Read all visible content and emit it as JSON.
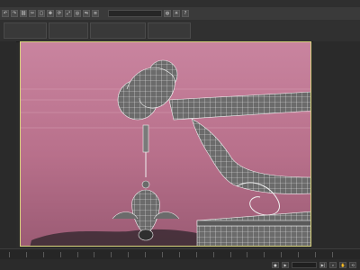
{
  "menu": {
    "items": []
  },
  "toolbar": {
    "search_placeholder": ""
  },
  "viewport": {
    "label": ""
  },
  "status": {
    "frame": ""
  },
  "colors": {
    "viewport_top": "#c9849f",
    "viewport_bottom": "#9b5b74",
    "viewport_border": "#d7d27c",
    "ui_dark": "#2b2b2b"
  }
}
